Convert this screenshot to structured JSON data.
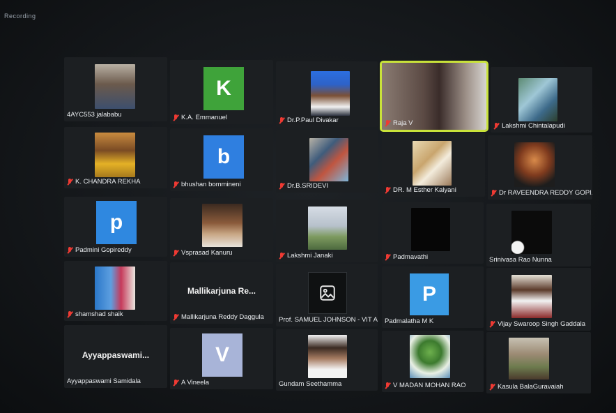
{
  "status": {
    "recording_label": "Recording"
  },
  "participants": [
    {
      "name": "4AYC553 jalababu",
      "muted": false
    },
    {
      "name": "K.A. Emmanuel",
      "muted": true,
      "avatar_letter": "K",
      "avatar_color": "#3fa33a"
    },
    {
      "name": "Dr.P.Paul Divakar",
      "muted": true
    },
    {
      "name": "Raja V",
      "muted": true,
      "active_speaker": true
    },
    {
      "name": "Lakshmi Chintalapudi",
      "muted": true
    },
    {
      "name": "K. CHANDRA REKHA",
      "muted": true
    },
    {
      "name": "bhushan bommineni",
      "muted": true,
      "avatar_letter": "b",
      "avatar_color": "#2f7fe0"
    },
    {
      "name": "Dr.B.SRIDEVI",
      "muted": true
    },
    {
      "name": "DR. M Esther Kalyani",
      "muted": true
    },
    {
      "name": "Dr RAVEENDRA REDDY GOPI...",
      "muted": true
    },
    {
      "name": "Padmini Gopireddy",
      "muted": true,
      "avatar_letter": "p",
      "avatar_color": "#2f88e0"
    },
    {
      "name": "Vsprasad Kanuru",
      "muted": true
    },
    {
      "name": "Lakshmi Janaki",
      "muted": true
    },
    {
      "name": "Padmavathi",
      "muted": true
    },
    {
      "name": "Srinivasa Rao Nunna",
      "muted": false
    },
    {
      "name": "shamshad shaik",
      "muted": true
    },
    {
      "name": "Mallikarjuna Reddy Daggula",
      "muted": true,
      "display_text": "Mallikarjuna  Re..."
    },
    {
      "name": "Prof. SAMUEL JOHNSON - VIT A...",
      "muted": false
    },
    {
      "name": "Padmalatha M K",
      "muted": false,
      "avatar_letter": "P",
      "avatar_color": "#3a9be4"
    },
    {
      "name": "Vijay Swaroop Singh Gaddala",
      "muted": true
    },
    {
      "name": "Ayyappaswami Samidala",
      "muted": false,
      "display_text": "Ayyappaswami..."
    },
    {
      "name": "A Vineela",
      "muted": true,
      "avatar_letter": "V",
      "avatar_color": "#a8b4d8"
    },
    {
      "name": "Gundam Seethamma",
      "muted": false
    },
    {
      "name": "V MADAN MOHAN RAO",
      "muted": true
    },
    {
      "name": "Kasula BalaGuravaiah",
      "muted": true
    }
  ],
  "icons": {
    "muted": "mic-muted-icon",
    "no_photo": "image-placeholder-icon"
  }
}
